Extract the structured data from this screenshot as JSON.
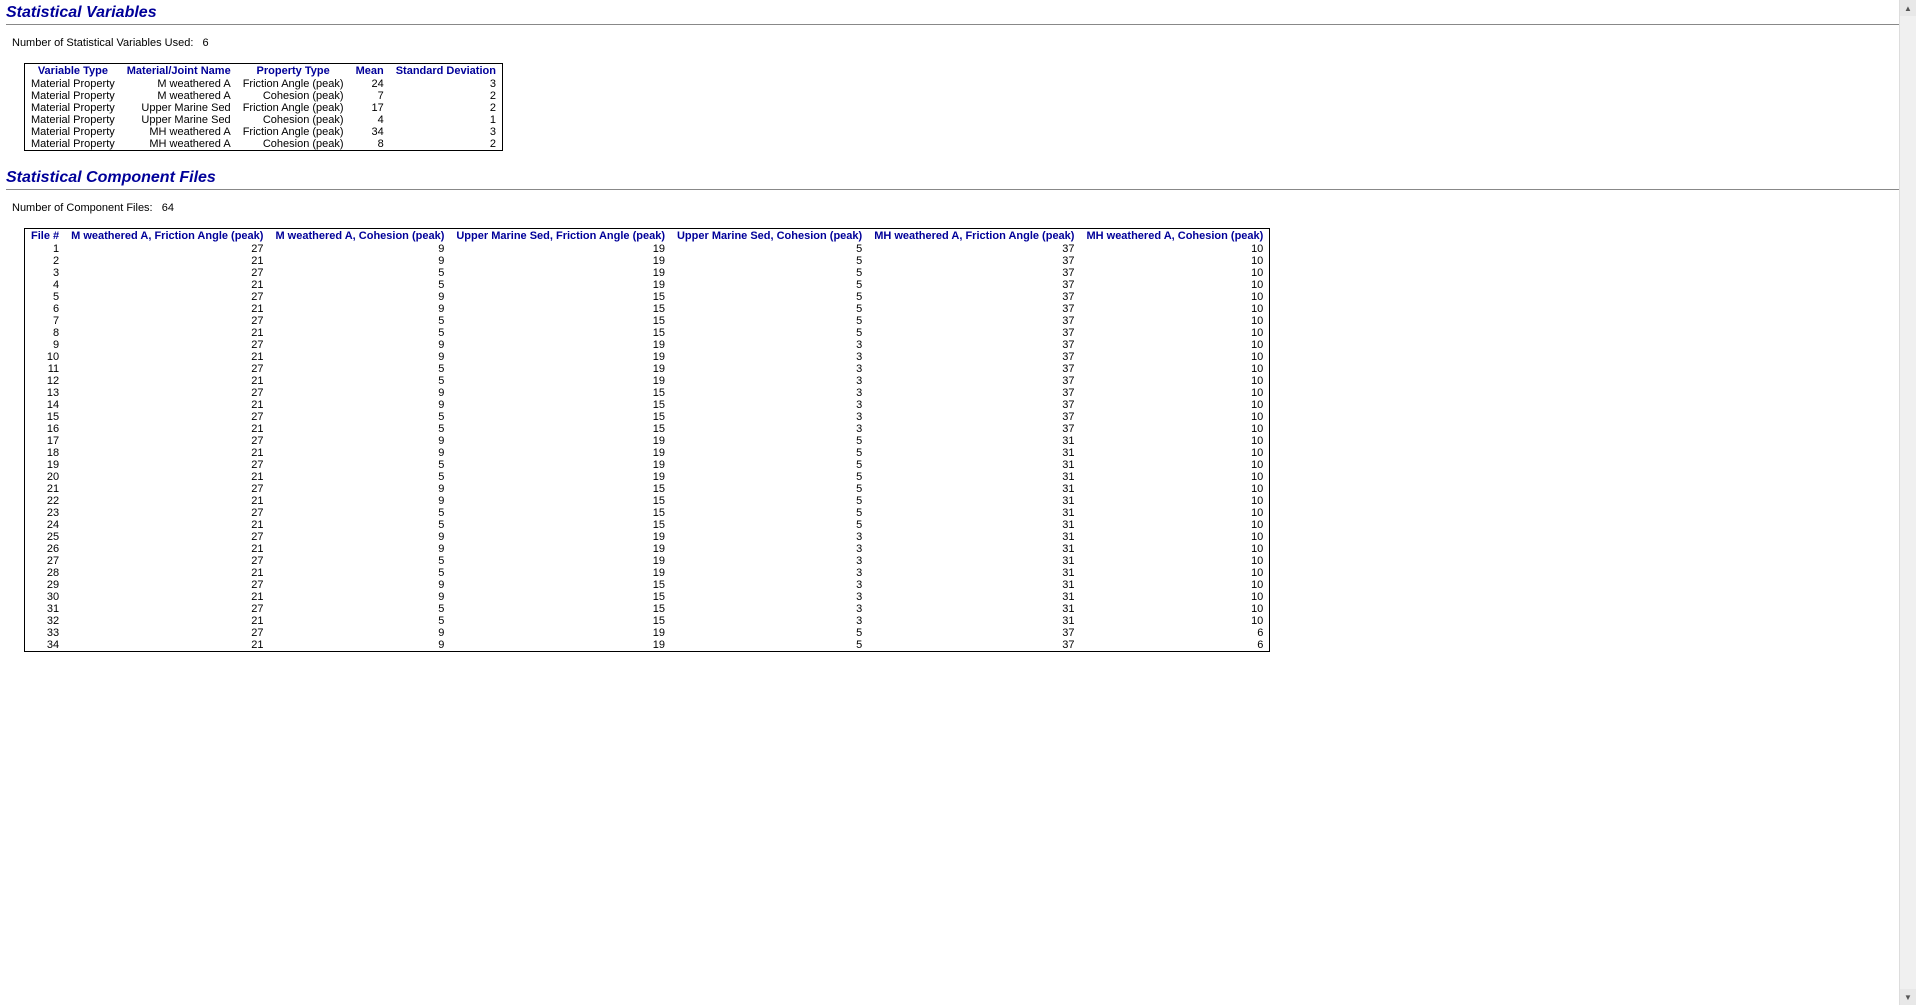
{
  "sections": {
    "vars": {
      "title": "Statistical Variables",
      "count_label": "Number of Statistical Variables Used:",
      "count": "6",
      "headers": [
        "Variable Type",
        "Material/Joint Name",
        "Property Type",
        "Mean",
        "Standard Deviation"
      ],
      "rows": [
        [
          "Material Property",
          "M weathered A",
          "Friction Angle (peak)",
          "24",
          "3"
        ],
        [
          "Material Property",
          "M weathered A",
          "Cohesion (peak)",
          "7",
          "2"
        ],
        [
          "Material Property",
          "Upper Marine Sed",
          "Friction Angle (peak)",
          "17",
          "2"
        ],
        [
          "Material Property",
          "Upper Marine Sed",
          "Cohesion (peak)",
          "4",
          "1"
        ],
        [
          "Material Property",
          "MH weathered A",
          "Friction Angle (peak)",
          "34",
          "3"
        ],
        [
          "Material Property",
          "MH weathered A",
          "Cohesion (peak)",
          "8",
          "2"
        ]
      ],
      "aligns": [
        "left",
        "right",
        "right",
        "right",
        "right"
      ]
    },
    "files": {
      "title": "Statistical Component Files",
      "count_label": "Number of Component Files:",
      "count": "64",
      "headers": [
        "File #",
        "M weathered A, Friction Angle (peak)",
        "M weathered A, Cohesion (peak)",
        "Upper Marine Sed, Friction Angle (peak)",
        "Upper Marine Sed, Cohesion (peak)",
        "MH weathered A, Friction Angle (peak)",
        "MH weathered A, Cohesion (peak)"
      ],
      "rows": [
        [
          "1",
          "27",
          "9",
          "19",
          "5",
          "37",
          "10"
        ],
        [
          "2",
          "21",
          "9",
          "19",
          "5",
          "37",
          "10"
        ],
        [
          "3",
          "27",
          "5",
          "19",
          "5",
          "37",
          "10"
        ],
        [
          "4",
          "21",
          "5",
          "19",
          "5",
          "37",
          "10"
        ],
        [
          "5",
          "27",
          "9",
          "15",
          "5",
          "37",
          "10"
        ],
        [
          "6",
          "21",
          "9",
          "15",
          "5",
          "37",
          "10"
        ],
        [
          "7",
          "27",
          "5",
          "15",
          "5",
          "37",
          "10"
        ],
        [
          "8",
          "21",
          "5",
          "15",
          "5",
          "37",
          "10"
        ],
        [
          "9",
          "27",
          "9",
          "19",
          "3",
          "37",
          "10"
        ],
        [
          "10",
          "21",
          "9",
          "19",
          "3",
          "37",
          "10"
        ],
        [
          "11",
          "27",
          "5",
          "19",
          "3",
          "37",
          "10"
        ],
        [
          "12",
          "21",
          "5",
          "19",
          "3",
          "37",
          "10"
        ],
        [
          "13",
          "27",
          "9",
          "15",
          "3",
          "37",
          "10"
        ],
        [
          "14",
          "21",
          "9",
          "15",
          "3",
          "37",
          "10"
        ],
        [
          "15",
          "27",
          "5",
          "15",
          "3",
          "37",
          "10"
        ],
        [
          "16",
          "21",
          "5",
          "15",
          "3",
          "37",
          "10"
        ],
        [
          "17",
          "27",
          "9",
          "19",
          "5",
          "31",
          "10"
        ],
        [
          "18",
          "21",
          "9",
          "19",
          "5",
          "31",
          "10"
        ],
        [
          "19",
          "27",
          "5",
          "19",
          "5",
          "31",
          "10"
        ],
        [
          "20",
          "21",
          "5",
          "19",
          "5",
          "31",
          "10"
        ],
        [
          "21",
          "27",
          "9",
          "15",
          "5",
          "31",
          "10"
        ],
        [
          "22",
          "21",
          "9",
          "15",
          "5",
          "31",
          "10"
        ],
        [
          "23",
          "27",
          "5",
          "15",
          "5",
          "31",
          "10"
        ],
        [
          "24",
          "21",
          "5",
          "15",
          "5",
          "31",
          "10"
        ],
        [
          "25",
          "27",
          "9",
          "19",
          "3",
          "31",
          "10"
        ],
        [
          "26",
          "21",
          "9",
          "19",
          "3",
          "31",
          "10"
        ],
        [
          "27",
          "27",
          "5",
          "19",
          "3",
          "31",
          "10"
        ],
        [
          "28",
          "21",
          "5",
          "19",
          "3",
          "31",
          "10"
        ],
        [
          "29",
          "27",
          "9",
          "15",
          "3",
          "31",
          "10"
        ],
        [
          "30",
          "21",
          "9",
          "15",
          "3",
          "31",
          "10"
        ],
        [
          "31",
          "27",
          "5",
          "15",
          "3",
          "31",
          "10"
        ],
        [
          "32",
          "21",
          "5",
          "15",
          "3",
          "31",
          "10"
        ],
        [
          "33",
          "27",
          "9",
          "19",
          "5",
          "37",
          "6"
        ],
        [
          "34",
          "21",
          "9",
          "19",
          "5",
          "37",
          "6"
        ]
      ],
      "aligns": [
        "right",
        "right",
        "right",
        "right",
        "right",
        "right",
        "right"
      ]
    }
  }
}
